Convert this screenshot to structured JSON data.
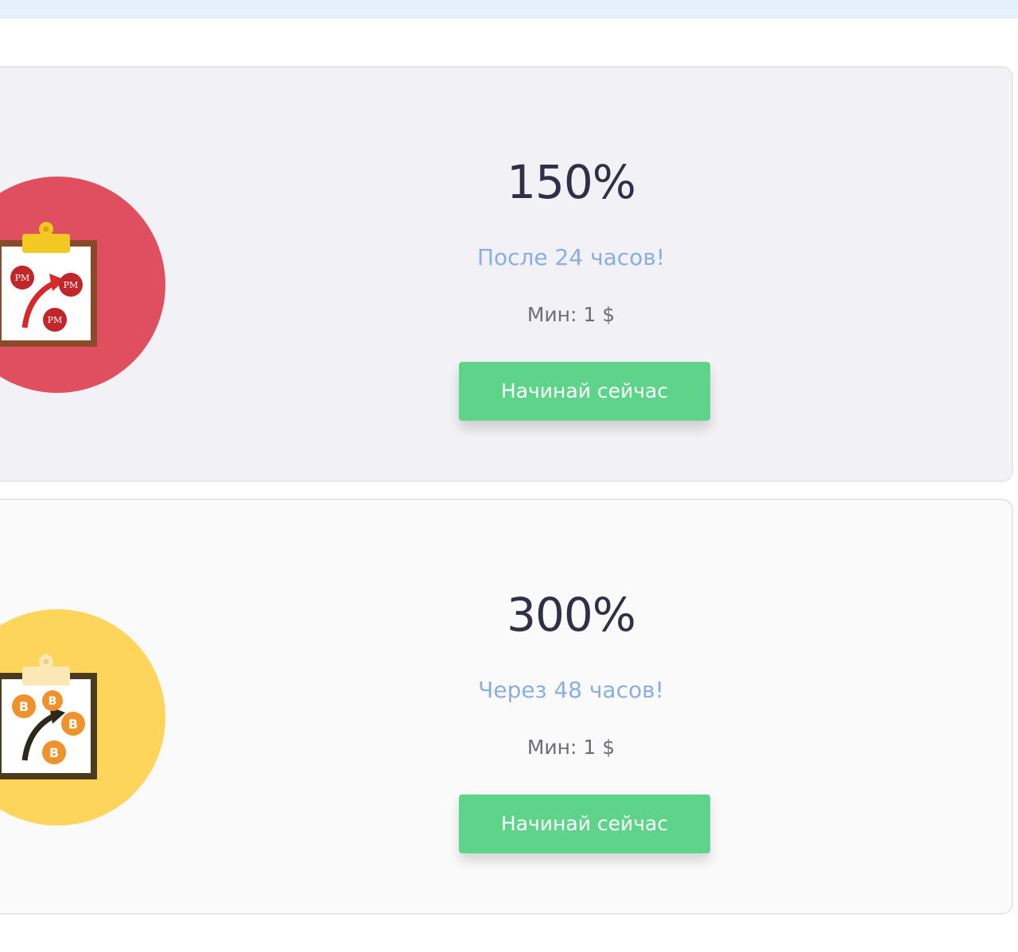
{
  "plans": [
    {
      "rate": "150%",
      "term": "После 24 часов!",
      "min": "Мин: 1 $",
      "button_label": "Начинай сейчас",
      "icon": "clipboard-perfect-money-icon",
      "icon_bg": "#e04f5f",
      "coin_label": "PM"
    },
    {
      "rate": "300%",
      "term": "Через 48 часов!",
      "min": "Мин: 1 $",
      "button_label": "Начинай сейчас",
      "icon": "clipboard-bitcoin-icon",
      "icon_bg": "#fdd55b",
      "coin_label": "B"
    }
  ],
  "colors": {
    "accent_green": "#5ed38a",
    "term_blue": "#8aaee2",
    "rate_dark": "#2f3047"
  }
}
